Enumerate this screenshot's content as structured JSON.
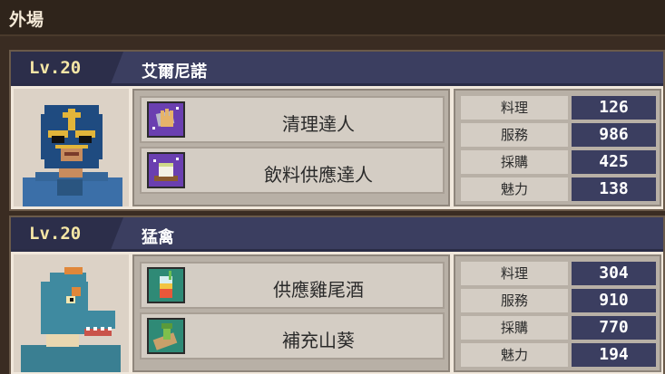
{
  "header": {
    "title": "外場"
  },
  "staff": [
    {
      "level": "Lv.20",
      "name": "艾爾尼諾",
      "portrait_icon": "masked-wrestler-portrait",
      "skills": [
        {
          "label": "清理達人",
          "icon": "cleaning-cloth-icon",
          "icon_bg": "#6a3fb0"
        },
        {
          "label": "飲料供應達人",
          "icon": "drink-cup-icon",
          "icon_bg": "#6a3fb0"
        }
      ],
      "stats": [
        {
          "label": "料理",
          "value": "126"
        },
        {
          "label": "服務",
          "value": "986"
        },
        {
          "label": "採購",
          "value": "425"
        },
        {
          "label": "魅力",
          "value": "138"
        }
      ]
    },
    {
      "level": "Lv.20",
      "name": "猛禽",
      "portrait_icon": "raptor-portrait",
      "skills": [
        {
          "label": "供應雞尾酒",
          "icon": "cocktail-glass-icon",
          "icon_bg": "#2f8a76"
        },
        {
          "label": "補充山葵",
          "icon": "wasabi-grater-icon",
          "icon_bg": "#2f8a76"
        }
      ],
      "stats": [
        {
          "label": "料理",
          "value": "304"
        },
        {
          "label": "服務",
          "value": "910"
        },
        {
          "label": "採購",
          "value": "770"
        },
        {
          "label": "魅力",
          "value": "194"
        }
      ]
    }
  ]
}
